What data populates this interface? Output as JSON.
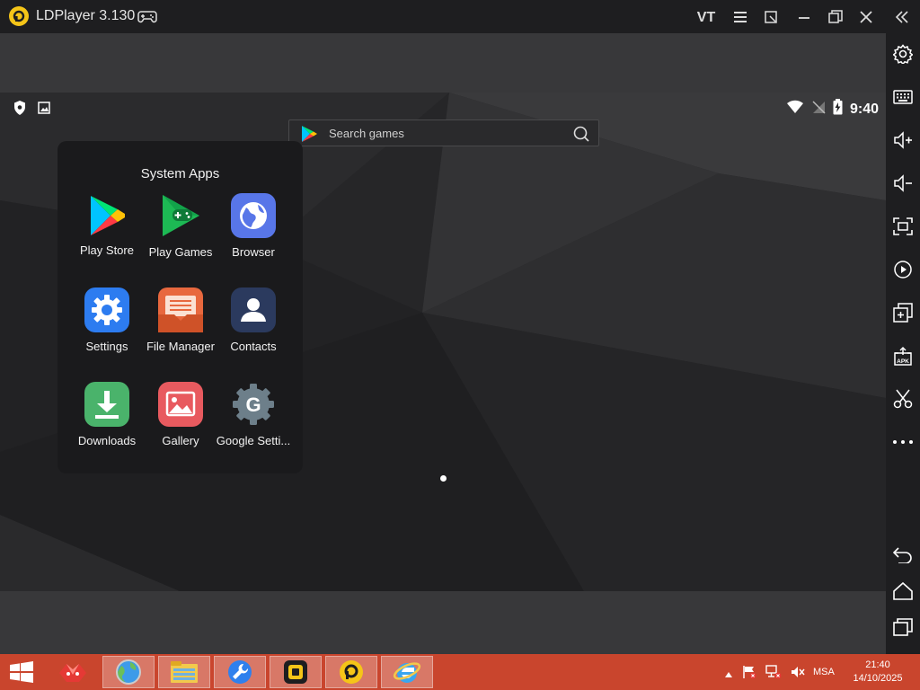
{
  "window": {
    "title": "LDPlayer 3.130",
    "vt_label": "VT"
  },
  "status_bar": {
    "time": "9:40"
  },
  "search": {
    "placeholder": "Search games"
  },
  "folder": {
    "title": "System Apps",
    "apps": [
      {
        "label": "Play Store",
        "icon": "play-store-icon"
      },
      {
        "label": "Play Games",
        "icon": "play-games-icon"
      },
      {
        "label": "Browser",
        "icon": "browser-icon"
      },
      {
        "label": "Settings",
        "icon": "settings-icon"
      },
      {
        "label": "File Manager",
        "icon": "file-manager-icon"
      },
      {
        "label": "Contacts",
        "icon": "contacts-icon"
      },
      {
        "label": "Downloads",
        "icon": "downloads-icon"
      },
      {
        "label": "Gallery",
        "icon": "gallery-icon"
      },
      {
        "label": "Google Setti...",
        "icon": "google-settings-icon"
      }
    ]
  },
  "sidebar": {
    "items": [
      "settings-icon",
      "keyboard-icon",
      "volume-up-icon",
      "volume-down-icon",
      "fullscreen-icon",
      "screen-record-icon",
      "multi-instance-icon",
      "apk-install-icon",
      "scissors-icon",
      "more-icon",
      "back-icon",
      "home-icon",
      "recents-icon"
    ]
  },
  "taskbar": {
    "items": [
      "windows-start-icon",
      "app-red-icon",
      "globe-icon",
      "file-explorer-icon",
      "tools-icon",
      "ldplayer-multi-icon",
      "ldplayer-icon",
      "internet-explorer-icon"
    ],
    "language": "MSA",
    "clock_time": "21:40",
    "clock_date": "14/10/2025"
  },
  "colors": {
    "taskbar": "#c9452d",
    "ldplayer_yellow": "#f5c518",
    "titlebar": "#1e1e20"
  }
}
